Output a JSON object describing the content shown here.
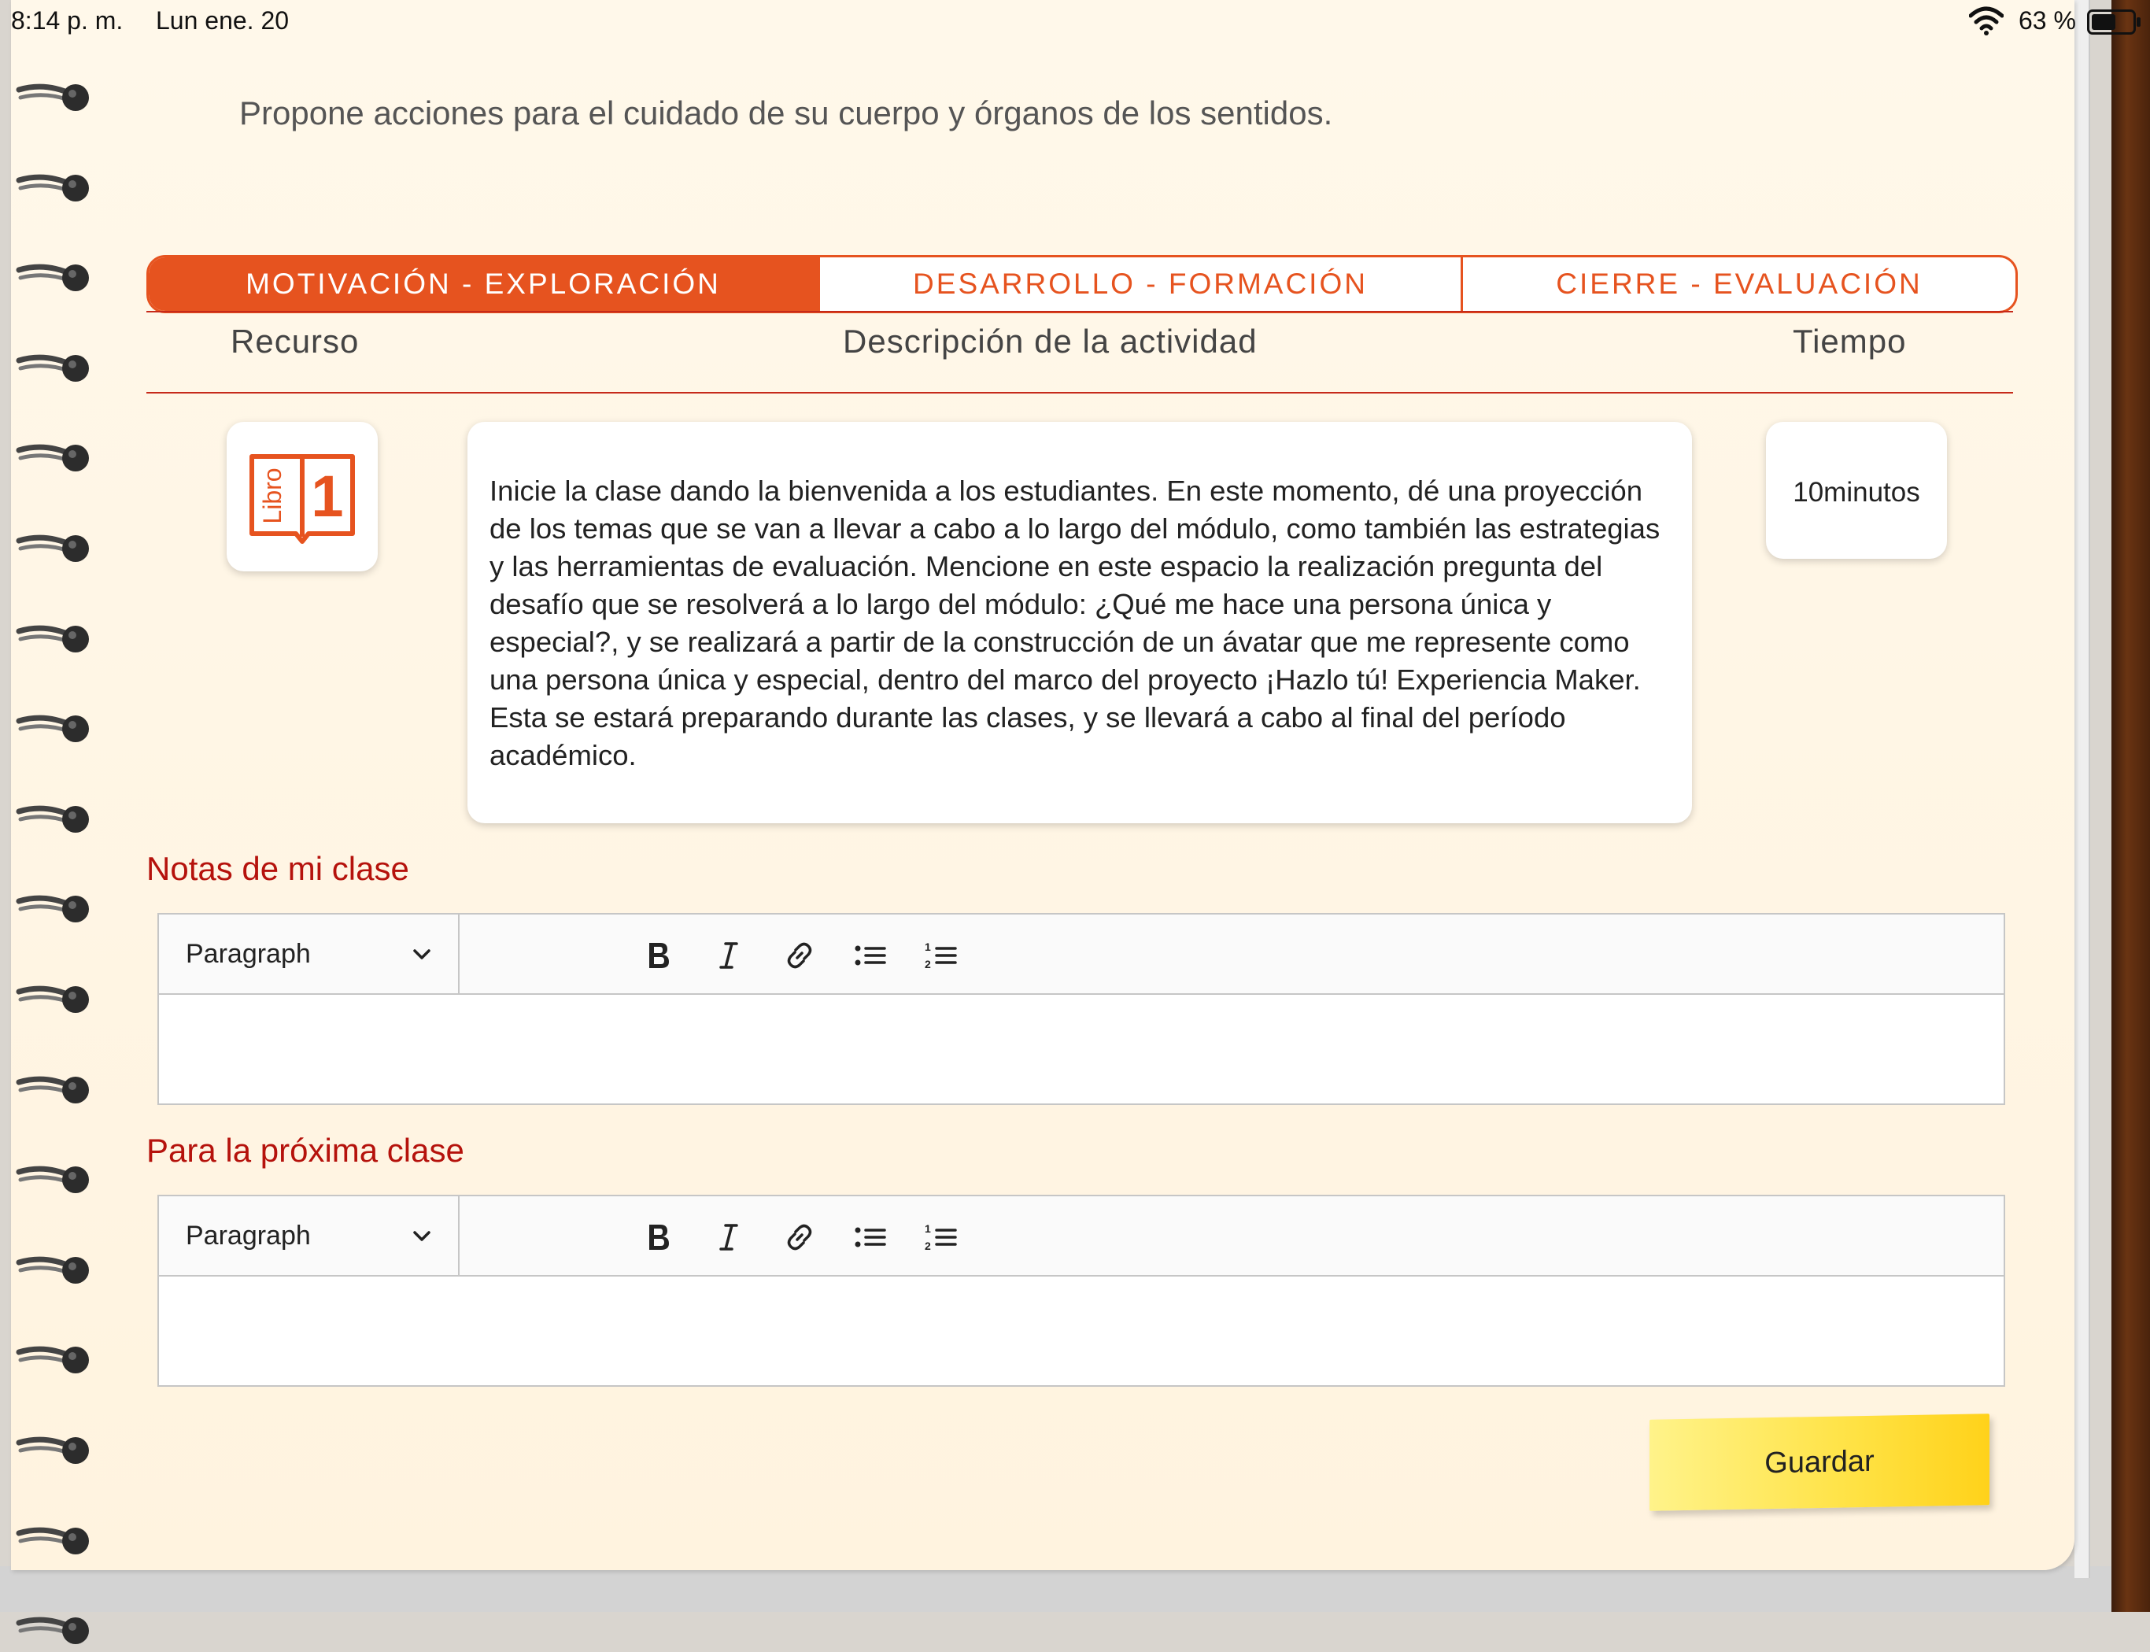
{
  "status_bar": {
    "time": "8:14 p. m.",
    "date": "Lun ene. 20",
    "battery": "63 %"
  },
  "subtitle": "Propone acciones para el cuidado de su cuerpo y órganos de los sentidos.",
  "tabs": [
    {
      "label": "MOTIVACIÓN - EXPLORACIÓN",
      "active": true
    },
    {
      "label": "DESARROLLO - FORMACIÓN",
      "active": false
    },
    {
      "label": "CIERRE - EVALUACIÓN",
      "active": false
    }
  ],
  "columns": {
    "resource": "Recurso",
    "description": "Descripción de la actividad",
    "time": "Tiempo"
  },
  "activity": {
    "resource_icon": "libro-1-icon",
    "resource_label": "Libro",
    "resource_number": "1",
    "description": "Inicie la clase dando la bienvenida a los estudiantes. En este momento, dé una proyección de los temas que se van a llevar a cabo a lo largo del módulo, como también las estrategias y las herramientas de evaluación. Mencione en este espacio la realización pregunta del desafío que se resolverá a lo largo del módulo: ¿Qué me hace una persona única y especial?, y se realizará a partir de la construcción de un ávatar que me represente como una persona única y especial, dentro del marco del proyecto ¡Hazlo tú! Experiencia Maker. Esta se estará preparando durante las clases, y se llevará a cabo al final del período académico.",
    "time": "10minutos"
  },
  "notes": {
    "label": "Notas de mi clase",
    "format": "Paragraph",
    "content": ""
  },
  "next_class": {
    "label": "Para la próxima clase",
    "format": "Paragraph",
    "content": ""
  },
  "save_label": "Guardar",
  "colors": {
    "accent": "#e6531f",
    "section_label": "#b5120c",
    "save_button": "#ffe244"
  }
}
